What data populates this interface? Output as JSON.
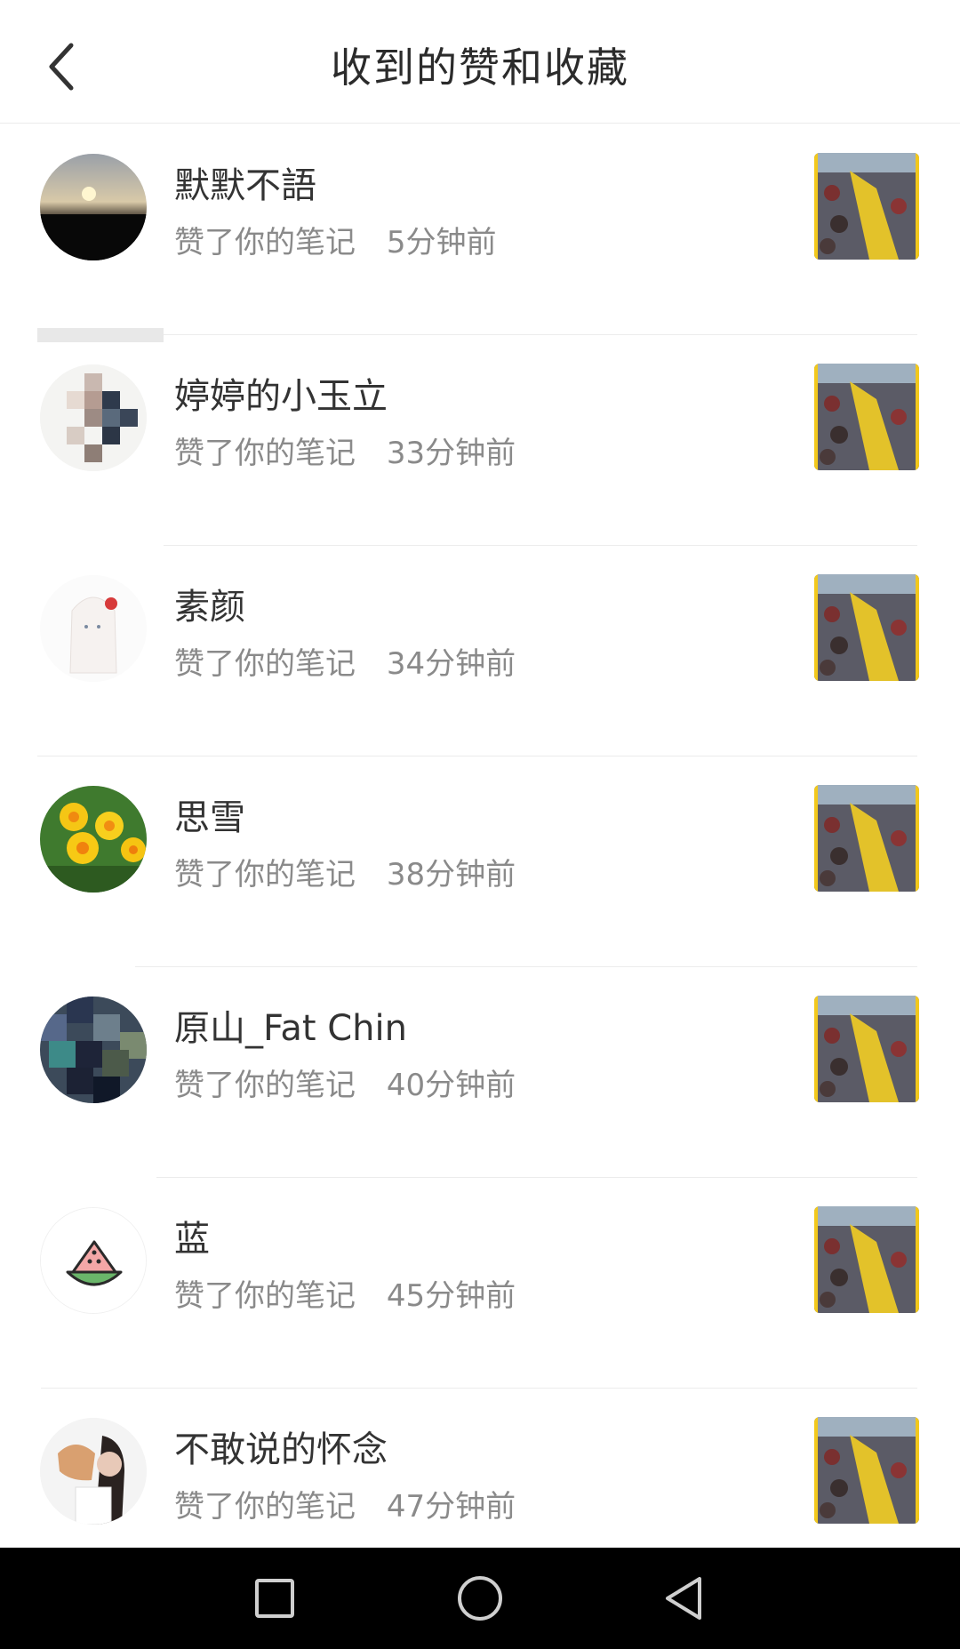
{
  "header": {
    "back_icon": "chevron-left-icon",
    "title": "收到的赞和收藏"
  },
  "notifications": [
    {
      "name": "默默不語",
      "action": "赞了你的笔记",
      "time": "5分钟前"
    },
    {
      "name": "婷婷的小玉立",
      "action": "赞了你的笔记",
      "time": "33分钟前"
    },
    {
      "name": "素颜",
      "action": "赞了你的笔记",
      "time": "34分钟前"
    },
    {
      "name": "思雪",
      "action": "赞了你的笔记",
      "time": "38分钟前"
    },
    {
      "name": "原山_Fat Chin",
      "action": "赞了你的笔记",
      "time": "40分钟前"
    },
    {
      "name": "蓝",
      "action": "赞了你的笔记",
      "time": "45分钟前"
    },
    {
      "name": "不敢说的怀念",
      "action": "赞了你的笔记",
      "time": "47分钟前"
    }
  ],
  "navbar": {
    "recents_icon": "square-icon",
    "home_icon": "circle-icon",
    "back_icon": "triangle-back-icon"
  },
  "colors": {
    "thumb_accent": "#f2c81c",
    "divider": "#ececec",
    "meta_text": "#8a8a8a"
  }
}
